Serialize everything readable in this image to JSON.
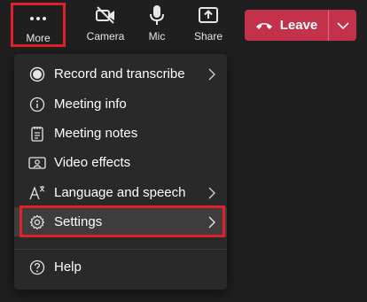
{
  "toolbar": {
    "more_label": "More",
    "camera_label": "Camera",
    "mic_label": "Mic",
    "share_label": "Share",
    "leave_label": "Leave"
  },
  "menu": {
    "items": [
      {
        "label": "Record and transcribe",
        "icon": "record-icon",
        "submenu": true
      },
      {
        "label": "Meeting info",
        "icon": "info-icon",
        "submenu": false
      },
      {
        "label": "Meeting notes",
        "icon": "notes-icon",
        "submenu": false
      },
      {
        "label": "Video effects",
        "icon": "video-effects-icon",
        "submenu": false
      },
      {
        "label": "Language and speech",
        "icon": "language-icon",
        "submenu": true
      },
      {
        "label": "Settings",
        "icon": "gear-icon",
        "submenu": true,
        "highlighted": true
      },
      {
        "label": "Help",
        "icon": "help-icon",
        "submenu": false
      }
    ]
  },
  "colors": {
    "background": "#1f1f1f",
    "menu_bg": "#292929",
    "leave_button": "#c4314b",
    "highlight_outline": "#e0202b"
  }
}
